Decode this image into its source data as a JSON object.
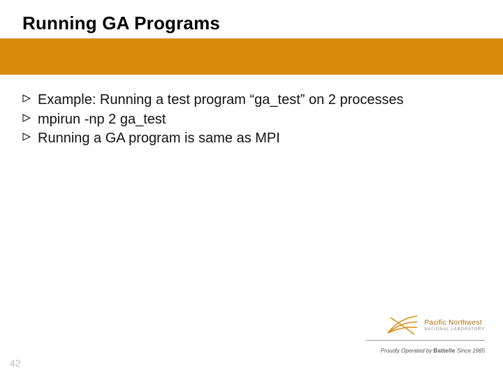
{
  "title": "Running GA Programs",
  "bullets": [
    "Example: Running a test program “ga_test” on 2 processes",
    "mpirun -np 2 ga_test",
    "Running a GA program is same as MPI"
  ],
  "slide_number": "42",
  "logo": {
    "org_name": "Pacific Northwest",
    "org_sub": "NATIONAL LABORATORY",
    "tagline_prefix": "Proudly Operated by ",
    "tagline_brand": "Battelle",
    "tagline_suffix": " Since 1965"
  },
  "colors": {
    "accent": "#d98b0d"
  }
}
